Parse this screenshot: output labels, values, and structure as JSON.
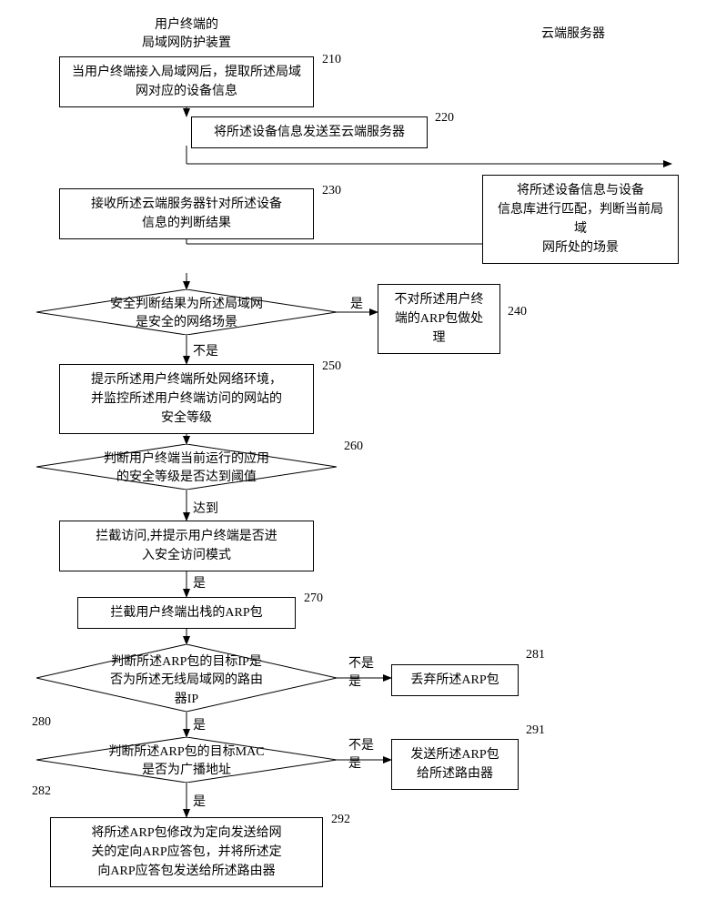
{
  "chart_data": {
    "type": "flowchart",
    "lanes": [
      {
        "id": "lane_left",
        "title": "用户终端的\n局域网防护装置"
      },
      {
        "id": "lane_right",
        "title": "云端服务器"
      }
    ],
    "nodes": [
      {
        "id": "n210",
        "lane": "lane_left",
        "shape": "rect",
        "num": "210",
        "text": "当用户终端接入局域网后，提取所述局域网对应的设备信息"
      },
      {
        "id": "n220",
        "lane": "lane_left",
        "shape": "rect",
        "num": "220",
        "text": "将所述设备信息发送至云端服务器"
      },
      {
        "id": "n_cloud",
        "lane": "lane_right",
        "shape": "rect",
        "text": "将所述设备信息与设备信息库进行匹配，判断当前局域网所处的场景"
      },
      {
        "id": "n230",
        "lane": "lane_left",
        "shape": "rect",
        "num": "230",
        "text": "接收所述云端服务器针对所述设备信息的判断结果"
      },
      {
        "id": "d1",
        "lane": "lane_left",
        "shape": "diamond",
        "text": "安全判断结果为所述局域网是安全的网络场景"
      },
      {
        "id": "n240",
        "lane": "lane_left",
        "shape": "rect",
        "num": "240",
        "text": "不对所述用户终端的ARP包做处理"
      },
      {
        "id": "n250",
        "lane": "lane_left",
        "shape": "rect",
        "num": "250",
        "text": "提示所述用户终端所处网络环境，并监控所述用户终端访问的网站的安全等级"
      },
      {
        "id": "d260",
        "lane": "lane_left",
        "shape": "diamond",
        "num": "260",
        "text": "判断用户终端当前运行的应用的安全等级是否达到阈值"
      },
      {
        "id": "n_intercept",
        "lane": "lane_left",
        "shape": "rect",
        "text": "拦截访问,并提示用户终端是否进入安全访问模式"
      },
      {
        "id": "n270",
        "lane": "lane_left",
        "shape": "rect",
        "num": "270",
        "text": "拦截用户终端出栈的ARP包"
      },
      {
        "id": "d280",
        "lane": "lane_left",
        "shape": "diamond",
        "num": "280",
        "text": "判断所述ARP包的目标IP是否为所述无线局域网的路由器IP"
      },
      {
        "id": "n281",
        "lane": "lane_left",
        "shape": "rect",
        "num": "281",
        "text": "丢弃所述ARP包"
      },
      {
        "id": "d282",
        "lane": "lane_left",
        "shape": "diamond",
        "num": "282",
        "text": "判断所述ARP包的目标MAC是否为广播地址"
      },
      {
        "id": "n291",
        "lane": "lane_left",
        "shape": "rect",
        "num": "291",
        "text": "发送所述ARP包给所述路由器"
      },
      {
        "id": "n292",
        "lane": "lane_left",
        "shape": "rect",
        "num": "292",
        "text": "将所述ARP包修改为定向发送给网关的定向ARP应答包，并将所述定向ARP应答包发送给所述路由器"
      }
    ],
    "edges": [
      {
        "from": "n210",
        "to": "n220"
      },
      {
        "from": "n220",
        "to": "n_cloud"
      },
      {
        "from": "n_cloud",
        "to": "n230"
      },
      {
        "from": "n230",
        "to": "d1"
      },
      {
        "from": "d1",
        "to": "n240",
        "label": "是"
      },
      {
        "from": "d1",
        "to": "n250",
        "label": "不是"
      },
      {
        "from": "n250",
        "to": "d260"
      },
      {
        "from": "d260",
        "to": "n_intercept",
        "label": "达到"
      },
      {
        "from": "n_intercept",
        "to": "n270",
        "label": "是"
      },
      {
        "from": "n270",
        "to": "d280"
      },
      {
        "from": "d280",
        "to": "n281",
        "label": "不是"
      },
      {
        "from": "d280",
        "to": "d282",
        "label": "是"
      },
      {
        "from": "d282",
        "to": "n291",
        "label": "不是"
      },
      {
        "from": "d282",
        "to": "n292",
        "label": "是"
      }
    ]
  },
  "lane_left_title_l1": "用户终端的",
  "lane_left_title_l2": "局域网防护装置",
  "lane_right_title": "云端服务器",
  "n210": "当用户终端接入局域网后，提取所述局域网对应的设备信息",
  "num210": "210",
  "n220": "将所述设备信息发送至云端服务器",
  "num220": "220",
  "n_cloud_l1": "将所述设备信息与设备",
  "n_cloud_l2": "信息库进行匹配，判断当前局域",
  "n_cloud_l3": "网所处的场景",
  "n230_l1": "接收所述云端服务器针对所述设备",
  "n230_l2": "信息的判断结果",
  "num230": "230",
  "d1_l1": "安全判断结果为所述局域网",
  "d1_l2": "是安全的网络场景",
  "n240_l1": "不对所述用户终",
  "n240_l2": "端的ARP包做处",
  "n240_l3": "理",
  "num240": "240",
  "n250_l1": "提示所述用户终端所处网络环境，",
  "n250_l2": "并监控所述用户终端访问的网站的",
  "n250_l3": "安全等级",
  "num250": "250",
  "d260_l1": "判断用户终端当前运行的应用",
  "d260_l2": "的安全等级是否达到阈值",
  "num260": "260",
  "n_intercept_l1": "拦截访问,并提示用户终端是否进",
  "n_intercept_l2": "入安全访问模式",
  "n270": "拦截用户终端出栈的ARP包",
  "num270": "270",
  "d280_l1": "判断所述ARP包的目标IP是",
  "d280_l2": "否为所述无线局域网的路由",
  "d280_l3": "器IP",
  "num280": "280",
  "n281": "丢弃所述ARP包",
  "num281": "281",
  "d282_l1": "判断所述ARP包的目标MAC",
  "d282_l2": "是否为广播地址",
  "num282": "282",
  "n291_l1": "发送所述ARP包",
  "n291_l2": "给所述路由器",
  "num291": "291",
  "n292_l1": "将所述ARP包修改为定向发送给网",
  "n292_l2": "关的定向ARP应答包，并将所述定",
  "n292_l3": "向ARP应答包发送给所述路由器",
  "num292": "292",
  "edge_yes": "是",
  "edge_no": "不是",
  "edge_reach": "达到"
}
